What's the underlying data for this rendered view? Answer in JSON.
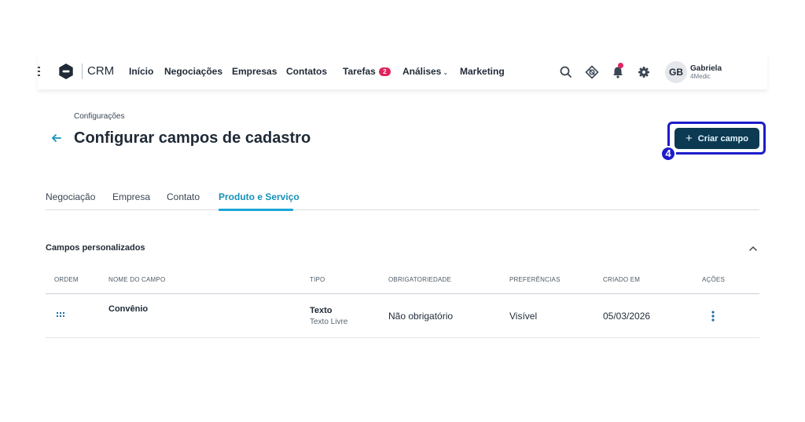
{
  "brand": {
    "name": "CRM"
  },
  "nav": {
    "items": [
      "Início",
      "Negociações",
      "Empresas",
      "Contatos"
    ],
    "tasks": {
      "label": "Tarefas",
      "count": "2"
    },
    "analytics": {
      "label": "Análises",
      "chevron": "⌄"
    },
    "marketing": "Marketing"
  },
  "topbar_icons": [
    "search-icon",
    "integrations-icon",
    "bell-icon",
    "gear-icon"
  ],
  "user": {
    "initials": "GB",
    "name": "Gabriela",
    "company": "4Medic"
  },
  "header": {
    "breadcrumb": "Configurações",
    "title": "Configurar campos de cadastro",
    "create_button": {
      "icon": "+",
      "label": "Criar campo"
    },
    "step_marker": "4"
  },
  "tabs": [
    "Negociação",
    "Empresa",
    "Contato",
    "Produto e Serviço"
  ],
  "active_tab": "Produto e Serviço",
  "section": {
    "title": "Campos personalizados",
    "columns": [
      "ORDEM",
      "NOME DO CAMPO",
      "TIPO",
      "OBRIGATORIEDADE",
      "PREFERÊNCIAS",
      "CRIADO EM",
      "AÇÕES"
    ],
    "rows": [
      {
        "name": "Convênio",
        "type": "Texto",
        "subtype": "Texto Livre",
        "required": "Não obrigatório",
        "preference": "Visível",
        "created_at": "05/03/2026"
      }
    ]
  },
  "colors": {
    "primary_dark": "#0b3a52",
    "accent": "#1aa6d6",
    "badge": "#e0245e",
    "highlight": "#1c1ccc"
  }
}
